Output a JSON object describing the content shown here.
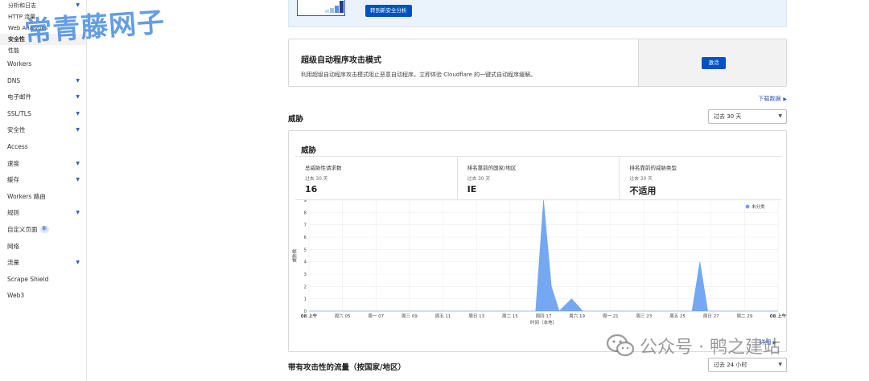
{
  "sidebar": {
    "sub_items": [
      {
        "label": "分析和日志",
        "caret": true,
        "active": false
      },
      {
        "label": "HTTP 流量",
        "caret": false,
        "active": false
      },
      {
        "label": "Web Analytics",
        "caret": false,
        "active": false
      },
      {
        "label": "安全性",
        "caret": false,
        "active": true
      },
      {
        "label": "性能",
        "caret": false,
        "active": false
      }
    ],
    "items": [
      {
        "label": "Workers",
        "caret": false
      },
      {
        "label": "DNS",
        "caret": true
      },
      {
        "label": "电子邮件",
        "caret": true
      },
      {
        "label": "SSL/TLS",
        "caret": true
      },
      {
        "label": "安全性",
        "caret": true
      },
      {
        "label": "Access",
        "caret": false
      },
      {
        "label": "速度",
        "caret": true
      },
      {
        "label": "缓存",
        "caret": true
      },
      {
        "label": "Workers 路由",
        "caret": false
      },
      {
        "label": "规则",
        "caret": true
      },
      {
        "label": "自定义页面",
        "caret": false,
        "badge": "新"
      },
      {
        "label": "网络",
        "caret": false
      },
      {
        "label": "流量",
        "caret": true
      },
      {
        "label": "Scrape Shield",
        "caret": false
      },
      {
        "label": "Web3",
        "caret": false
      }
    ]
  },
  "watermark": {
    "top": "常青藤网子",
    "bottom": "公众号 · 鸭之建站"
  },
  "promo": {
    "button": "转到新安全分析"
  },
  "sbfm": {
    "title": "超级自动程序攻击模式",
    "description": "利用超级自动程序攻击模式阻止恶意自动程序。立即体验 Cloudflare 的一键式自动程序缓解。",
    "button": "激活"
  },
  "download_link": "下载数据",
  "threats": {
    "section_title": "威胁",
    "range_select": "过去 30 天",
    "card_title": "威胁",
    "stats": [
      {
        "label": "总威胁性请求数",
        "sub": "过去 30 天",
        "value": "16"
      },
      {
        "label": "排名靠前的国家/地区",
        "sub": "过去 30 天",
        "value": "IE"
      },
      {
        "label": "排名靠前的威胁类型",
        "sub": "过去 30 天",
        "value": "不适用"
      }
    ],
    "footer_link": "详细"
  },
  "chart_data": {
    "type": "area",
    "ylabel": "威胁数",
    "xlabel": "时间（本地）",
    "legend": [
      {
        "name": "未分类",
        "color": "#6da3f2"
      }
    ],
    "legend_position": "top-right",
    "ylim": [
      0,
      9
    ],
    "y_ticks": [
      "0",
      "1",
      "2",
      "3",
      "4",
      "5",
      "6",
      "7",
      "8",
      "9"
    ],
    "x_ticks": [
      "08 上午",
      "周六 05",
      "周一 07",
      "周三 09",
      "周五 11",
      "周日 13",
      "周二 15",
      "周四 17",
      "周六 19",
      "周一 21",
      "周三 23",
      "周五 25",
      "周日 27",
      "周二 29",
      "08 上午"
    ],
    "grid": true,
    "series": [
      {
        "name": "未分类",
        "color": "#6da3f2",
        "points": [
          {
            "x": 0,
            "y": 0
          },
          {
            "x": 14.5,
            "y": 0
          },
          {
            "x": 15,
            "y": 9
          },
          {
            "x": 15.5,
            "y": 2
          },
          {
            "x": 16,
            "y": 0
          },
          {
            "x": 16.8,
            "y": 1
          },
          {
            "x": 17.5,
            "y": 0
          },
          {
            "x": 24.5,
            "y": 0
          },
          {
            "x": 25,
            "y": 4
          },
          {
            "x": 25.5,
            "y": 0
          },
          {
            "x": 30,
            "y": 0
          }
        ]
      }
    ]
  },
  "traffic": {
    "section_title": "带有攻击性的流量（按国家/地区）",
    "range_select": "过去 24 小时"
  }
}
